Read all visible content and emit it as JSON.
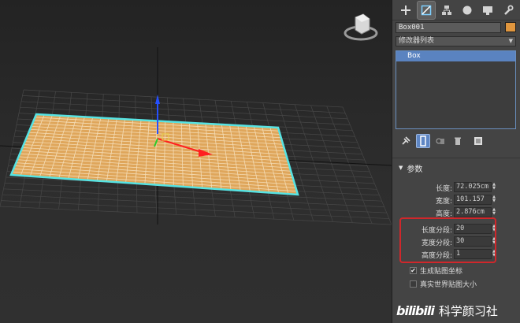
{
  "toolbar": {
    "tabs": [
      "create-icon",
      "modify-icon",
      "hierarchy-icon",
      "motion-icon",
      "display-icon",
      "utilities-icon"
    ]
  },
  "object": {
    "name": "Box001",
    "color": "#e0963e"
  },
  "modifier_list": {
    "label": "修改器列表"
  },
  "stack": {
    "items": [
      "Box"
    ]
  },
  "parameters": {
    "title": "参数",
    "length_label": "长度:",
    "length_value": "72.025cm",
    "width_label": "宽度:",
    "width_value": "101.157",
    "height_label": "高度:",
    "height_value": "2.876cm",
    "length_segs_label": "长度分段:",
    "length_segs_value": "20",
    "width_segs_label": "宽度分段:",
    "width_segs_value": "30",
    "height_segs_label": "高度分段:",
    "height_segs_value": "1",
    "gen_mapping_label": "生成贴图坐标",
    "gen_mapping_checked": true,
    "real_world_label": "真实世界贴图大小",
    "real_world_checked": false
  },
  "watermark": {
    "logo": "bilibili",
    "text": "科学颜习社"
  },
  "colors": {
    "plane_fill": "#dfa65b",
    "plane_grid": "#f4dcb5",
    "selection": "#56e3e3",
    "highlight": "#d0272b",
    "stack_selected": "#5a83c0"
  }
}
